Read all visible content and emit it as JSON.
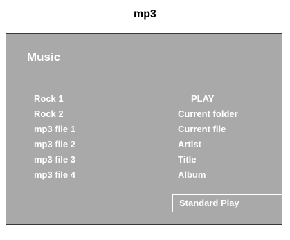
{
  "caption": "mp3",
  "screen": {
    "title": "Music",
    "files": [
      "Rock 1",
      "Rock 2",
      "mp3 file 1",
      "mp3 file 2",
      "mp3 file 3",
      "mp3 file 4"
    ],
    "options": [
      "PLAY",
      "Current folder",
      "Current file",
      "Artist",
      "Title",
      "Album"
    ],
    "play_mode": "Standard Play"
  },
  "colors": {
    "screen_background": "#a9a9a9",
    "text": "#ffffff"
  }
}
